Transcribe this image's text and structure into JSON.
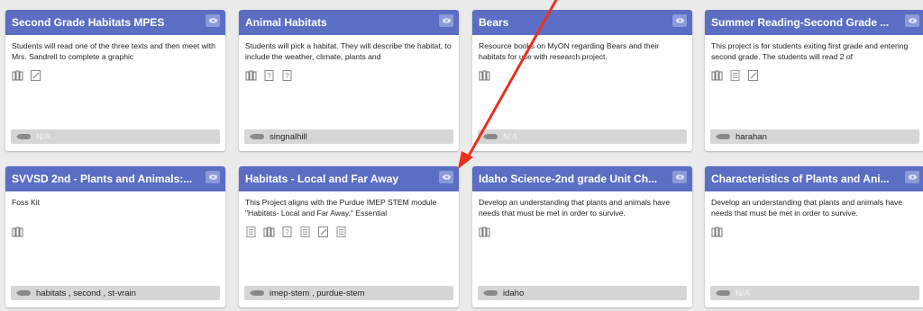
{
  "cards": [
    {
      "title": "Second Grade Habitats MPES",
      "desc": "Students will read one of the three texts and then meet with Mrs. Sandrell to complete a graphic",
      "icons": [
        "book-icon",
        "edit-icon"
      ],
      "tags": "N/A"
    },
    {
      "title": "Animal Habitats",
      "desc": "Students will pick a habitat. They will describe the habitat, to include the weather, climate, plants and",
      "icons": [
        "book-icon",
        "question-icon",
        "question-icon"
      ],
      "tags": "singnalhill"
    },
    {
      "title": "Bears",
      "desc": "Resource books on MyON regarding Bears and their habitats for use with research project.",
      "icons": [
        "book-icon"
      ],
      "tags": "N/A"
    },
    {
      "title": "Summer Reading-Second Grade ...",
      "desc": "This project is for students exiting first grade and entering second grade. The students will read 2 of",
      "icons": [
        "book-icon",
        "document-icon",
        "edit-icon"
      ],
      "tags": "harahan"
    },
    {
      "title": "SVVSD 2nd - Plants and Animals:...",
      "desc": "Foss Kit",
      "icons": [
        "book-icon"
      ],
      "tags": "habitats , second , st-vrain"
    },
    {
      "title": "Habitats - Local and Far Away",
      "desc": "This Project aligns with the Purdue IMEP STEM module \"Habitats- Local and Far Away.\" Essential",
      "icons": [
        "document-icon",
        "book-icon",
        "question-icon",
        "document-icon",
        "edit-icon",
        "document-icon"
      ],
      "tags": "imep-stem , purdue-stem"
    },
    {
      "title": "Idaho Science-2nd grade Unit Ch...",
      "desc": "Develop an understanding that plants and animals have needs that must be met in order to survive.",
      "icons": [
        "book-icon"
      ],
      "tags": "idaho"
    },
    {
      "title": "Characteristics of Plants and Ani...",
      "desc": "Develop an understanding that plants and animals have needs that must be met in order to survive.",
      "icons": [
        "book-icon"
      ],
      "tags": "N/A"
    }
  ],
  "colors": {
    "header": "#5b6ec4",
    "arrow": "#e8321e"
  }
}
